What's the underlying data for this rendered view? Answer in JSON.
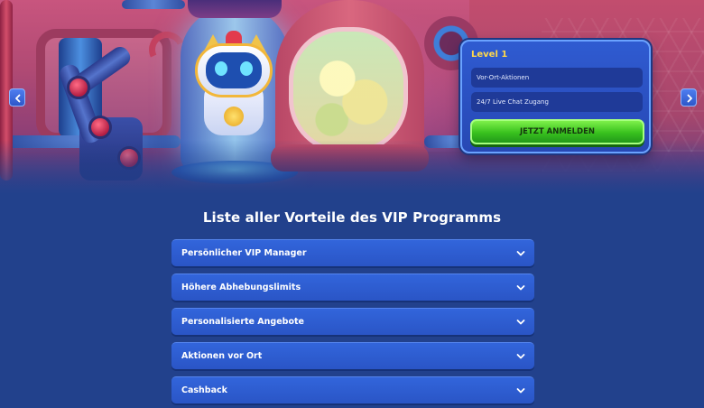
{
  "level_card": {
    "level_label": "Level 1",
    "perks": [
      "Vor-Ort-Aktionen",
      "24/7 Live Chat Zugang"
    ],
    "cta_label": "JETZT ANMELDEN"
  },
  "section_title": "Liste aller Vorteile des VIP Programms",
  "benefits": [
    {
      "label": "Persönlicher VIP Manager"
    },
    {
      "label": "Höhere Abhebungslimits"
    },
    {
      "label": "Personalisierte Angebote"
    },
    {
      "label": "Aktionen vor Ort"
    },
    {
      "label": "Cashback"
    }
  ],
  "colors": {
    "page_bg": "#22418c",
    "accordion_bg": "#2f5fd6",
    "cta_green": "#38c11e",
    "level_yellow": "#ffd84a"
  },
  "icons": {
    "prev": "chevron-left-icon",
    "next": "chevron-right-icon",
    "expand": "chevron-down-icon"
  }
}
